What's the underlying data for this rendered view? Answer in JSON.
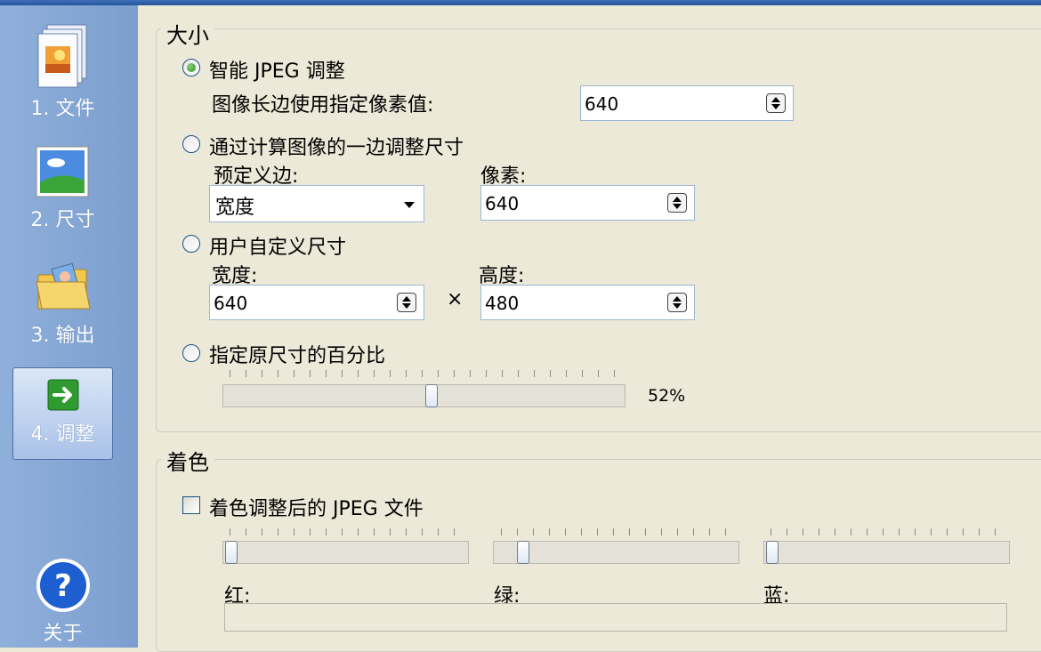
{
  "sidebar": {
    "items": [
      {
        "label": "1. 文件",
        "icon": "file-icon"
      },
      {
        "label": "2. 尺寸",
        "icon": "picture-icon"
      },
      {
        "label": "3. 输出",
        "icon": "folder-icon"
      },
      {
        "label": "4. 调整",
        "icon": "arrow-right-icon"
      }
    ],
    "help_label": "关于"
  },
  "size_group": {
    "title": "大小",
    "smart_jpeg": {
      "label": "智能 JPEG 调整",
      "long_edge_label": "图像长边使用指定像素值:",
      "long_edge_value": "640"
    },
    "one_side": {
      "label": "通过计算图像的一边调整尺寸",
      "predefined_side_label": "预定义边:",
      "predefined_side_value": "宽度",
      "pixels_label": "像素:",
      "pixels_value": "640"
    },
    "custom": {
      "label": "用户自定义尺寸",
      "width_label": "宽度:",
      "width_value": "640",
      "times_symbol": "×",
      "height_label": "高度:",
      "height_value": "480"
    },
    "percent": {
      "label": "指定原尺寸的百分比",
      "value_text": "52%",
      "value": 52
    }
  },
  "color_group": {
    "title": "着色",
    "colorize_label": "着色调整后的 JPEG 文件",
    "red_label": "红:",
    "green_label": "绿:",
    "blue_label": "蓝:"
  },
  "colors": {
    "sidebar": "#8fb0da",
    "background": "#ece9d8",
    "accent": "#2e8f23"
  }
}
